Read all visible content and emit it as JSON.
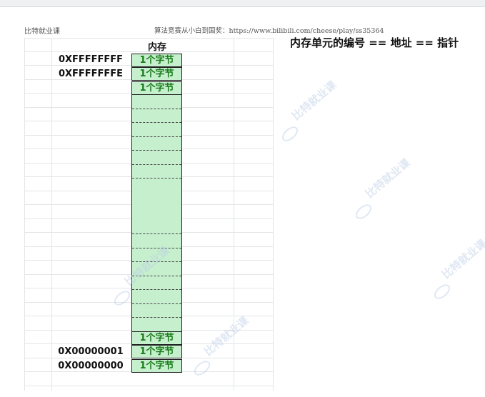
{
  "header": {
    "left_label": "比特就业课",
    "course_text": "算法竞赛从小白到国奖：https://www.bilibili.com/cheese/play/ss35364"
  },
  "title": "内存单元的编号 == 地址 == 指针",
  "memory": {
    "column_title": "内存",
    "cell_label": "1个字节",
    "top_addresses": [
      "0XFFFFFFFF",
      "0XFFFFFFFE"
    ],
    "bottom_addresses": [
      "0X00000001",
      "0X00000000"
    ]
  },
  "watermark": "比特就业课",
  "colors": {
    "cell_fill": "#c6efce",
    "cell_text": "#1a7d1a",
    "watermark": "#b9cbe6"
  }
}
